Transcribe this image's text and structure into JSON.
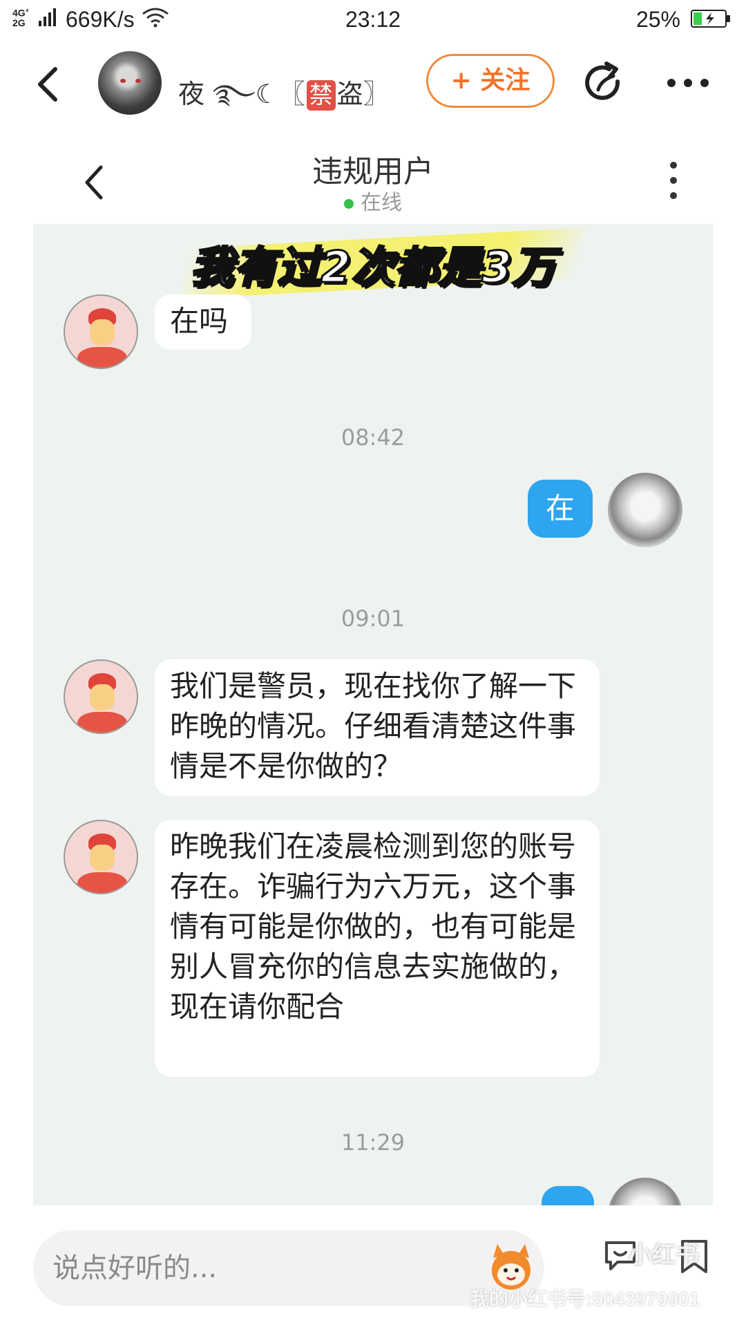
{
  "status_bar": {
    "network": "4G 2G",
    "speed": "669K/s",
    "time": "23:12",
    "battery": "25%"
  },
  "app_bar": {
    "username_prefix": "夜 ࿐☾〖",
    "ban_char": "禁",
    "username_suffix": "盗〗",
    "follow_label": "+ 关注"
  },
  "conversation": {
    "title": "违规用户",
    "status": "在线"
  },
  "overlay_caption": "我有过2次都是3万",
  "messages": [
    {
      "side": "left",
      "text": "在吗"
    },
    {
      "type": "time",
      "text": "08:42"
    },
    {
      "side": "right",
      "text": "在"
    },
    {
      "type": "time",
      "text": "09:01"
    },
    {
      "side": "left",
      "text": "我们是警员，现在找你了解一下昨晚的情况。仔细看清楚这件事情是不是你做的？"
    },
    {
      "side": "left",
      "text": "昨晚我们在凌晨检测到您的账号存在。诈骗行为六万元，这个事情有可能是你做的，也有可能是别人冒充你的信息去实施做的，现在请你配合"
    },
    {
      "type": "time",
      "text": "11:29"
    }
  ],
  "input_bar": {
    "placeholder": "说点好听的...",
    "watermark": "我的小红书号:5043979901",
    "watermark_logo": "小红书"
  },
  "colors": {
    "follow_accent": "#f0732c",
    "self_bubble": "#2ea5f0",
    "chat_background": "#eef3f0",
    "online_dot": "#33c24d",
    "ban_badge": "#e25145"
  },
  "icons": [
    "back-icon",
    "share-icon",
    "more-icon",
    "comment-icon",
    "collect-icon",
    "mascot-icon"
  ]
}
